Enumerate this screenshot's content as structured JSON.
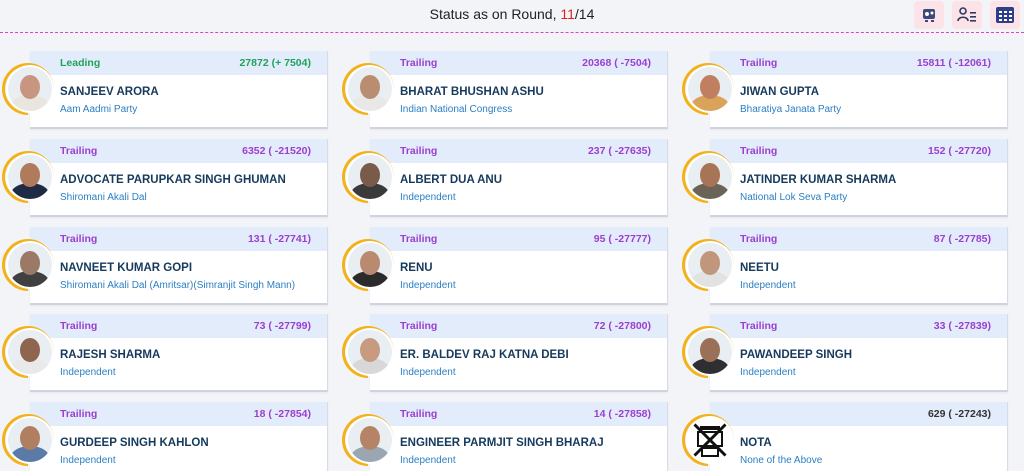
{
  "header": {
    "status_prefix": "Status as on Round, ",
    "current_round": "11",
    "total_rounds": "/14"
  },
  "toolbar": [
    {
      "name": "results-grid-icon-button",
      "icon": "network-icon"
    },
    {
      "name": "candidate-list-icon-button",
      "icon": "user-list-icon"
    },
    {
      "name": "table-view-icon-button",
      "icon": "calendar-grid-icon"
    }
  ],
  "colors": {
    "leading": "#1fa25b",
    "trailing": "#9b3fcf",
    "name": "#163a5c",
    "party": "#2a7fc4",
    "ring": "#f3b21a",
    "card_header": "#e3ecfb"
  },
  "candidates": [
    {
      "status": "Leading",
      "votes": "27872 (+ 7504)",
      "name": "SANJEEV ARORA",
      "party": "Aam Aadmi Party",
      "skin": "#c89580",
      "shirt": "#e9e5df"
    },
    {
      "status": "Trailing",
      "votes": "20368 ( -7504)",
      "name": "BHARAT BHUSHAN ASHU",
      "party": "Indian National Congress",
      "skin": "#b98d6f",
      "shirt": "#e8e8e8"
    },
    {
      "status": "Trailing",
      "votes": "15811 ( -12061)",
      "name": "JIWAN GUPTA",
      "party": "Bharatiya Janata Party",
      "skin": "#c08060",
      "shirt": "#d9a35a"
    },
    {
      "status": "Trailing",
      "votes": "6352 ( -21520)",
      "name": "ADVOCATE PARUPKAR SINGH GHUMAN",
      "party": "Shiromani Akali Dal",
      "skin": "#b07a5c",
      "shirt": "#1f2a44"
    },
    {
      "status": "Trailing",
      "votes": "237 ( -27635)",
      "name": "ALBERT DUA ANU",
      "party": "Independent",
      "skin": "#7a5a48",
      "shirt": "#3a3a3a"
    },
    {
      "status": "Trailing",
      "votes": "152 ( -27720)",
      "name": "JATINDER KUMAR SHARMA",
      "party": "National Lok Seva Party",
      "skin": "#a87456",
      "shirt": "#6b6358"
    },
    {
      "status": "Trailing",
      "votes": "131 ( -27741)",
      "name": "NAVNEET KUMAR GOPI",
      "party": "Shiromani Akali Dal (Amritsar)(Simranjit Singh Mann)",
      "skin": "#9a7a66",
      "shirt": "#404040"
    },
    {
      "status": "Trailing",
      "votes": "95 ( -27777)",
      "name": "RENU",
      "party": "Independent",
      "skin": "#b98a70",
      "shirt": "#2b2b2b"
    },
    {
      "status": "Trailing",
      "votes": "87 ( -27785)",
      "name": "NEETU",
      "party": "Independent",
      "skin": "#c0977c",
      "shirt": "#e2e2e2"
    },
    {
      "status": "Trailing",
      "votes": "73 ( -27799)",
      "name": "RAJESH SHARMA",
      "party": "Independent",
      "skin": "#8f6550",
      "shirt": "#e9e9e9"
    },
    {
      "status": "Trailing",
      "votes": "72 ( -27800)",
      "name": "ER. BALDEV RAJ KATNA DEBI",
      "party": "Independent",
      "skin": "#c89a80",
      "shirt": "#d8d8d8"
    },
    {
      "status": "Trailing",
      "votes": "33 ( -27839)",
      "name": "PAWANDEEP SINGH",
      "party": "Independent",
      "skin": "#9a7058",
      "shirt": "#2f2f33"
    },
    {
      "status": "Trailing",
      "votes": "18 ( -27854)",
      "name": "GURDEEP SINGH KAHLON",
      "party": "Independent",
      "skin": "#b07f60",
      "shirt": "#5a7aa8"
    },
    {
      "status": "Trailing",
      "votes": "14 ( -27858)",
      "name": "ENGINEER PARMJIT SINGH BHARAJ",
      "party": "Independent",
      "skin": "#b58466",
      "shirt": "#9aa6b2"
    },
    {
      "status": "",
      "votes": "629 ( -27243)",
      "name": "NOTA",
      "party": "None of the Above",
      "skin": "",
      "shirt": ""
    }
  ]
}
